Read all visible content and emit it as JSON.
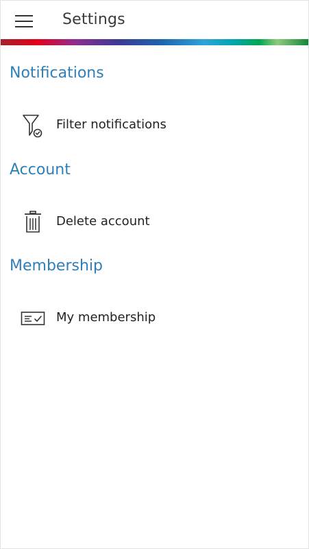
{
  "appbar": {
    "title": "Settings",
    "menu_icon": "hamburger-menu-icon"
  },
  "brand_stripe": {
    "colors": [
      "#b4232f",
      "#e20015",
      "#7d3f98",
      "#3b3b98",
      "#1f6fb5",
      "#2aa0d8",
      "#00a8b0",
      "#00a651",
      "#7cc576",
      "#1d8a3c"
    ]
  },
  "sections": [
    {
      "heading": "Notifications",
      "items": [
        {
          "label": "Filter notifications",
          "icon": "filter-icon"
        }
      ]
    },
    {
      "heading": "Account",
      "items": [
        {
          "label": "Delete account",
          "icon": "trash-icon"
        }
      ]
    },
    {
      "heading": "Membership",
      "items": [
        {
          "label": "My membership",
          "icon": "membership-card-icon"
        }
      ]
    }
  ]
}
